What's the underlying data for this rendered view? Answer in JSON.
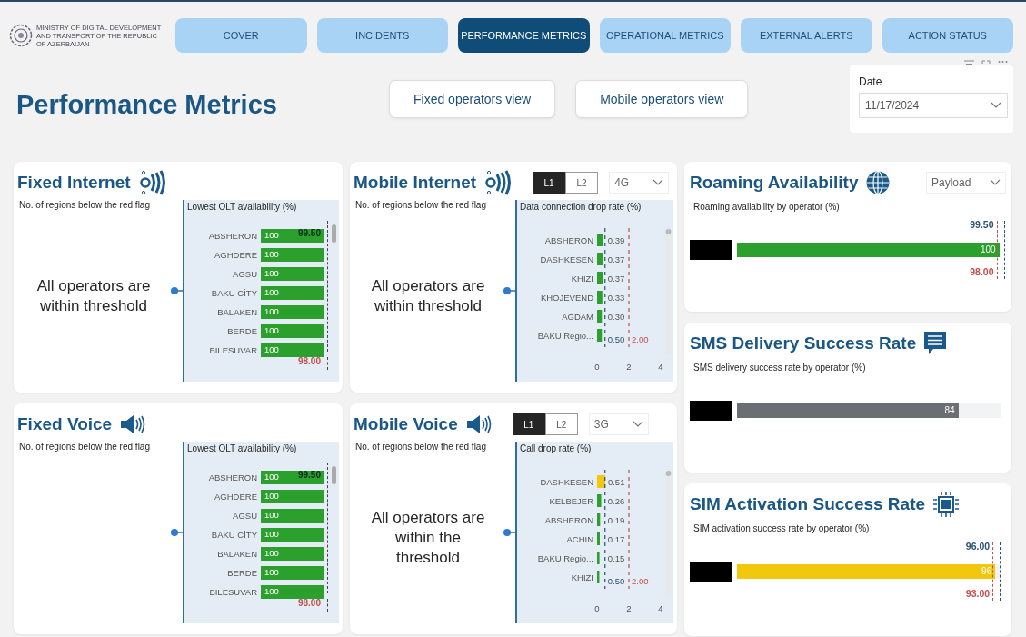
{
  "header": {
    "logo_text": "MINISTRY OF DIGITAL DEVELOPMENT AND TRANSPORT OF THE REPUBLIC OF AZERBAIJAN",
    "nav": [
      {
        "label": "COVER",
        "selected": false
      },
      {
        "label": "INCIDENTS",
        "selected": false
      },
      {
        "label": "PERFORMANCE METRICS",
        "selected": true
      },
      {
        "label": "OPERATIONAL METRICS",
        "selected": false
      },
      {
        "label": "EXTERNAL ALERTS",
        "selected": false
      },
      {
        "label": "ACTION STATUS",
        "selected": false
      }
    ]
  },
  "title": "Performance Metrics",
  "view_buttons": [
    "Fixed operators view",
    "Mobile operators view"
  ],
  "date_filter": {
    "label": "Date",
    "value": "11/17/2024"
  },
  "fixed_internet": {
    "title": "Fixed Internet",
    "left_caption": "No. of regions below the red flag",
    "status_text": "All operators are within threshold",
    "bar_list": {
      "title": "Lowest OLT availability (%)",
      "rows": [
        {
          "label": "ABSHERON",
          "value": "100",
          "level": 1
        },
        {
          "label": "AGHDERE",
          "value": "100",
          "level": 1
        },
        {
          "label": "AGSU",
          "value": "100",
          "level": 1
        },
        {
          "label": "BAKU CİTY",
          "value": "100",
          "level": 1
        },
        {
          "label": "BALAKEN",
          "value": "100",
          "level": 1
        },
        {
          "label": "BERDE",
          "value": "100",
          "level": 1
        },
        {
          "label": "BILESUVAR",
          "value": "100",
          "level": 1
        }
      ],
      "targets": [
        {
          "label": "99.50",
          "color": "#0a2e1a"
        },
        {
          "label": "98.00",
          "color": "#c0504d"
        }
      ]
    }
  },
  "mobile_internet": {
    "title": "Mobile Internet",
    "toggles": [
      {
        "label": "L1",
        "selected": true
      },
      {
        "label": "L2",
        "selected": false
      }
    ],
    "technology": "4G",
    "left_caption": "No. of regions below the red flag",
    "status_text": "All operators are within threshold",
    "chart_data": {
      "type": "bar",
      "orientation": "horizontal",
      "title": "Data connection drop rate (%)",
      "categories": [
        "ABSHERON",
        "DASHKESEN",
        "KHIZI",
        "KHOJEVEND",
        "AGDAM",
        "BAKU Regio..."
      ],
      "xlim": [
        0,
        4
      ],
      "xticks": [
        0,
        2,
        4
      ],
      "series": [
        {
          "color": "#2ca02c",
          "values": [
            0.39,
            0.37,
            0.37,
            0.33,
            0.3,
            0.3
          ]
        }
      ],
      "value_labels": [
        "0.39",
        "0.37",
        "0.37",
        "0.33",
        "0.30",
        null
      ],
      "ref_lines": [
        {
          "axis": "x",
          "value": 0.5,
          "label": "0.50",
          "color": "#2f4f6f"
        },
        {
          "axis": "x",
          "value": 2,
          "label": "2.00",
          "color": "#c0504d"
        }
      ]
    }
  },
  "fixed_voice": {
    "title": "Fixed Voice",
    "left_caption": "No. of regions below the red flag",
    "bar_list": {
      "title": "Lowest OLT availability (%)",
      "rows": [
        {
          "label": "ABSHERON",
          "value": "100",
          "level": 1
        },
        {
          "label": "AGHDERE",
          "value": "100",
          "level": 1
        },
        {
          "label": "AGSU",
          "value": "100",
          "level": 1
        },
        {
          "label": "BAKU CİTY",
          "value": "100",
          "level": 1
        },
        {
          "label": "BALAKEN",
          "value": "100",
          "level": 1
        },
        {
          "label": "BERDE",
          "value": "100",
          "level": 1
        },
        {
          "label": "BILESUVAR",
          "value": "100",
          "level": 1
        }
      ],
      "targets": [
        {
          "label": "99.50",
          "color": "#0a2e1a"
        },
        {
          "label": "98.00",
          "color": "#c0504d"
        }
      ]
    }
  },
  "mobile_voice": {
    "title": "Mobile Voice",
    "toggles": [
      {
        "label": "L1",
        "selected": true
      },
      {
        "label": "L2",
        "selected": false
      }
    ],
    "technology": "3G",
    "left_caption": "No. of regions below the red flag",
    "status_text": "All operators are within the threshold",
    "chart_data": {
      "type": "bar",
      "orientation": "horizontal",
      "title": "Call drop rate (%)",
      "categories": [
        "DASHKESEN",
        "KELBEJER",
        "ABSHERON",
        "LACHIN",
        "BAKU Regio...",
        "KHIZI"
      ],
      "xlim": [
        0,
        4
      ],
      "xticks": [
        0,
        2,
        4
      ],
      "series": [
        {
          "color": "#f2c80f",
          "values": [
            0.51,
            null,
            null,
            null,
            null,
            null
          ]
        },
        {
          "color": "#2ca02c",
          "values": [
            null,
            0.26,
            0.19,
            0.17,
            0.15,
            0.14
          ]
        }
      ],
      "value_labels": [
        "0.51",
        "0.26",
        "0.19",
        "0.17",
        "0.15",
        null
      ],
      "ref_lines": [
        {
          "axis": "x",
          "value": 0.5,
          "label": "0.50",
          "color": "#2f4f6f"
        },
        {
          "axis": "x",
          "value": 2,
          "label": "2.00",
          "color": "#c0504d"
        }
      ]
    }
  },
  "roaming": {
    "title": "Roaming Availability",
    "dropdown": "Payload",
    "bar": {
      "title": "Roaming availability by operator (%)",
      "value": "100",
      "level": 0.995,
      "color": "#2ca02c",
      "targets": [
        {
          "label": "99.50",
          "color": "#2f4f6f"
        },
        {
          "label": "98.00",
          "color": "#c0504d"
        }
      ]
    }
  },
  "sms": {
    "title": "SMS Delivery Success Rate",
    "bar": {
      "title": "SMS delivery success rate by operator (%)",
      "value": "84",
      "level": 0.84,
      "color": "#6b6e73"
    }
  },
  "sim": {
    "title": "SIM Activation Success Rate",
    "bar": {
      "title": "SIM activation success rate by operator (%)",
      "value": "96",
      "level": 0.98,
      "color": "#f2c80f",
      "targets": [
        {
          "label": "96.00",
          "color": "#2f4f6f"
        },
        {
          "label": "93.00",
          "color": "#c0504d"
        }
      ]
    }
  }
}
